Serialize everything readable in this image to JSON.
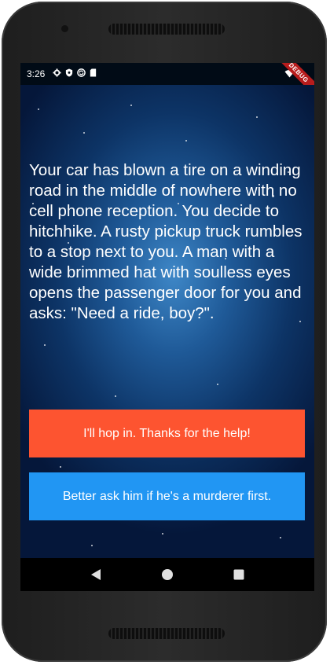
{
  "status_bar": {
    "time": "3:26",
    "left_icons": [
      "settings-icon",
      "shield-icon",
      "sync-icon",
      "sd-card-icon"
    ],
    "right_icons": [
      "wifi-icon",
      "battery-icon"
    ]
  },
  "debug_banner": "DEBUG",
  "story": {
    "text": "Your car has blown a tire on a winding road in the middle of nowhere with no cell phone reception. You decide to hitchhike. A rusty pickup truck rumbles to a stop next to you. A man with a wide brimmed hat with soulless eyes opens the passenger door for you and asks: \"Need a ride, boy?\"."
  },
  "choices": [
    {
      "label": "I'll hop in. Thanks for the help!",
      "color": "#FD5430"
    },
    {
      "label": "Better ask him if he's a murderer first.",
      "color": "#2196F3"
    }
  ],
  "nav_bar": {
    "icons": [
      "back-icon",
      "home-icon",
      "recents-icon"
    ]
  },
  "colors": {
    "background_top": "#05173A",
    "background_center": "#3E87C7"
  }
}
